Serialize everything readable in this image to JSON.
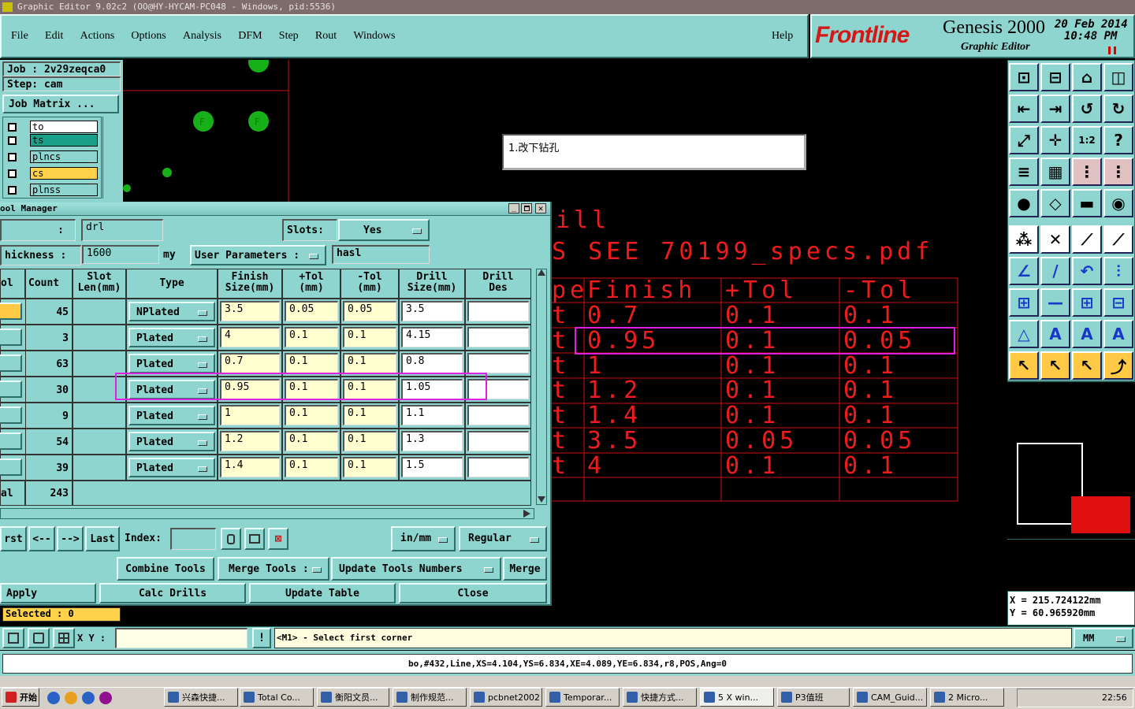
{
  "window_title": "Graphic Editor 9.02c2 (OO@HY-HYCAM-PC048 - Windows, pid:5536)",
  "menu": [
    "File",
    "Edit",
    "Actions",
    "Options",
    "Analysis",
    "DFM",
    "Step",
    "Rout",
    "Windows"
  ],
  "help": "Help",
  "brand": {
    "logo": "Frontline",
    "product": "Genesis 2000",
    "subtitle": "Graphic Editor",
    "date": "20 Feb 2014",
    "time": "10:48 PM"
  },
  "job": {
    "job_label": "Job : 2v29zeqca0",
    "step_label": "Step: cam",
    "job_matrix": "Job Matrix ..."
  },
  "layers": [
    {
      "name": "to",
      "color": "#ffffff"
    },
    {
      "name": "ts",
      "color": "#1aa088"
    },
    {
      "name": "plncs",
      "color": "#8ed5cf"
    },
    {
      "name": "cs",
      "color": "#ffd24a"
    },
    {
      "name": "plnss",
      "color": "#8ed5cf"
    }
  ],
  "note": "1.改下钻孔",
  "canvas_text": {
    "line1": "ill",
    "line2": "S SEE 70199_specs.pdf",
    "table_headers": [
      "pe",
      "Finish",
      "+Tol",
      "-Tol"
    ],
    "rows": [
      [
        "t",
        "0.7",
        "0.1",
        "0.1"
      ],
      [
        "t",
        "0.95",
        "0.1",
        "0.05"
      ],
      [
        "t",
        "1",
        "0.1",
        "0.1"
      ],
      [
        "t",
        "1.2",
        "0.1",
        "0.1"
      ],
      [
        "t",
        "1.4",
        "0.1",
        "0.1"
      ],
      [
        "t",
        "3.5",
        "0.05",
        "0.05"
      ],
      [
        "t",
        "4",
        "0.1",
        "0.1"
      ]
    ]
  },
  "tool_manager": {
    "title": "ool Manager",
    "layer_label": ":",
    "layer_value": "drl",
    "slots_label": "Slots:",
    "slots_value": "Yes",
    "thickness_label": "hickness :",
    "thickness_value": "1600",
    "thickness_unit": "my",
    "user_params_label": "User Parameters :",
    "user_params_value": "hasl",
    "columns": [
      "ol",
      "Count",
      "Slot\nLen(mm)",
      "Type",
      "Finish\nSize(mm)",
      "+Tol\n(mm)",
      "-Tol\n(mm)",
      "Drill\nSize(mm)",
      "Drill\nDes"
    ],
    "rows": [
      {
        "count": "45",
        "type": "NPlated",
        "finish": "3.5",
        "ptol": "0.05",
        "mtol": "0.05",
        "drill": "3.5",
        "des": ""
      },
      {
        "count": "3",
        "type": "Plated",
        "finish": "4",
        "ptol": "0.1",
        "mtol": "0.1",
        "drill": "4.15",
        "des": ""
      },
      {
        "count": "63",
        "type": "Plated",
        "finish": "0.7",
        "ptol": "0.1",
        "mtol": "0.1",
        "drill": "0.8",
        "des": ""
      },
      {
        "count": "30",
        "type": "Plated",
        "finish": "0.95",
        "ptol": "0.1",
        "mtol": "0.1",
        "drill": "1.05",
        "des": ""
      },
      {
        "count": "9",
        "type": "Plated",
        "finish": "1",
        "ptol": "0.1",
        "mtol": "0.1",
        "drill": "1.1",
        "des": ""
      },
      {
        "count": "54",
        "type": "Plated",
        "finish": "1.2",
        "ptol": "0.1",
        "mtol": "0.1",
        "drill": "1.3",
        "des": ""
      },
      {
        "count": "39",
        "type": "Plated",
        "finish": "1.4",
        "ptol": "0.1",
        "mtol": "0.1",
        "drill": "1.5",
        "des": ""
      }
    ],
    "total_label": "al",
    "total_count": "243",
    "nav": {
      "first": "rst",
      "prev": "<--",
      "next": "-->",
      "last": "Last",
      "index_label": "Index:",
      "index_value": "",
      "units": "in/mm",
      "mode": "Regular"
    },
    "actions1": {
      "combine": "Combine Tools",
      "merge_label": "Merge Tools :",
      "update_numbers": "Update Tools Numbers",
      "merge": "Merge"
    },
    "actions2": {
      "apply": "Apply",
      "calc": "Calc Drills",
      "update_table": "Update Table",
      "close": "Close"
    }
  },
  "status": {
    "selected": "Selected : 0",
    "xy_label": "X Y :",
    "xy_value": "",
    "prompt": "<M1> - Select first corner",
    "units": "MM",
    "info": "bo,#432,Line,XS=4.104,YS=6.834,XE=4.089,YE=6.834,r8,POS,Ang=0",
    "coord_x": "X  =  215.724122mm",
    "coord_y": "Y  =  60.965920mm"
  },
  "taskbar": {
    "start": "开始",
    "items": [
      "兴森快捷...",
      "Total Co...",
      "衡阳文员...",
      "制作规范...",
      "pcbnet2002",
      "Temporar...",
      "快捷方式...",
      "5 X win...",
      "P3值班",
      "CAM_Guid...",
      "2 Micro..."
    ],
    "clock": "22:56"
  }
}
